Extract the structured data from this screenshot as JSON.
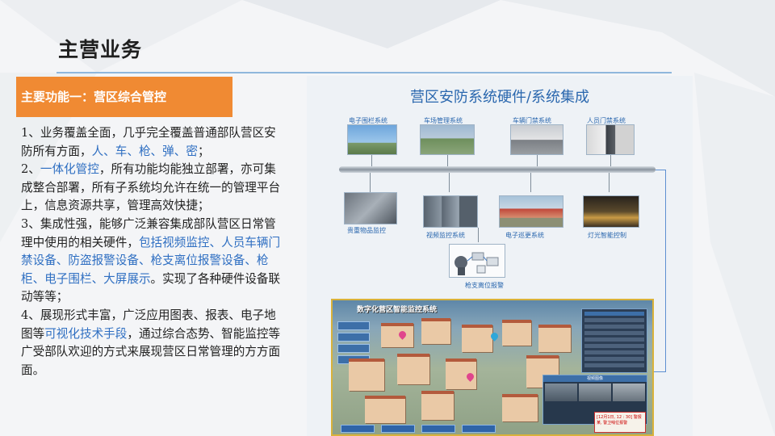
{
  "header": {
    "title": "主营业务"
  },
  "function_box": {
    "label": "主要功能一：营区综合管控"
  },
  "description": {
    "p1_a": "1、业务覆盖全面，几乎完全覆盖普通部队营区安防所有方面，",
    "p1_b": "人、车、枪、弹、密",
    "p1_c": "；",
    "p2_a": "2、",
    "p2_b": "一体化管控",
    "p2_c": "，所有功能均能独立部署，亦可集成整合部署，所有子系统均允许在统一的管理平台上，信息资源共享，管理高效快捷；",
    "p3_a": "3、集成性强，能够广泛兼容集成部队营区日常管理中使用的相关硬件，",
    "p3_b": "包括视频监控、人员车辆门禁设备、防盗报警设备、枪支离位报警设备、枪柜、电子围栏、大屏展示",
    "p3_c": "。实现了各种硬件设备联动等等；",
    "p4_a": "4、展现形式丰富，广泛应用图表、报表、电子地图等",
    "p4_b": "可视化技术手段",
    "p4_c": "，通过综合态势、智能监控等广受部队欢迎的方式来展现营区日常管理的方方面面。"
  },
  "diagram": {
    "title": "营区安防系统硬件/系统集成",
    "top_labels": [
      "电子围栏系统",
      "车场管理系统",
      "车辆门禁系统",
      "人员门禁系统"
    ],
    "bottom_labels": [
      "贵重物品监控",
      "视频监控系统",
      "电子巡更系统",
      "灯光智能控制"
    ],
    "gun_label": "枪支离位报警",
    "screen_title": "数字化营区智能监控系统",
    "video_label": "视频图像",
    "alert_text": "[12月1日, 12 : 30] 警报 某, 警卫哨位报警"
  },
  "colors": {
    "accent_orange": "#f08a33",
    "highlight_blue": "#2f6fc2",
    "diagram_blue": "#2a67ae"
  }
}
